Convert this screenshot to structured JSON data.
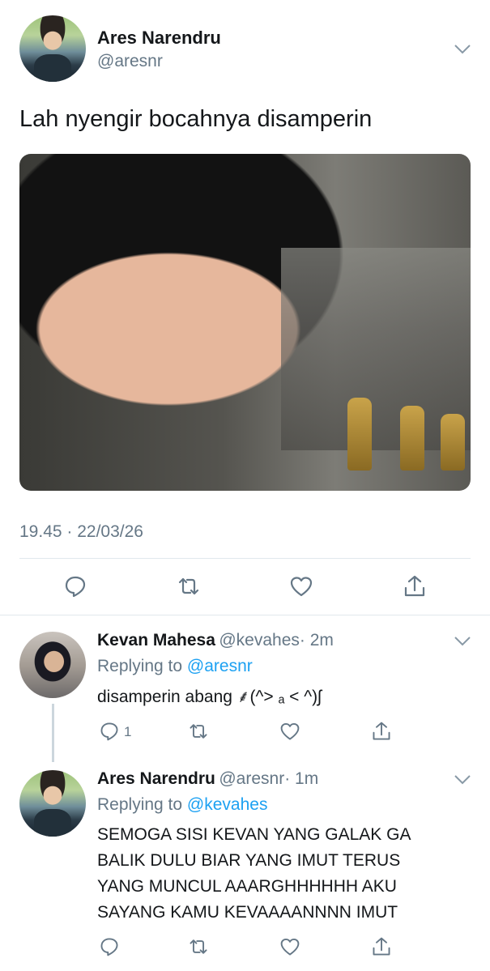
{
  "main_tweet": {
    "author_name": "Ares Narendru",
    "author_handle": "@aresnr",
    "text": "Lah nyengir bocahnya disamperin",
    "time": "19.45 · 22/03/26"
  },
  "replies": [
    {
      "author_name": "Kevan Mahesa",
      "author_handle": "@kevahes",
      "age": "· 2m",
      "replying_prefix": "Replying to",
      "replying_to": "@aresnr",
      "text": "disamperin abang ⸙(^> ₐ < ^)ʃ",
      "reply_count": "1"
    },
    {
      "author_name": "Ares Narendru",
      "author_handle": "@aresnr",
      "age": "· 1m",
      "replying_prefix": "Replying to",
      "replying_to": "@kevahes",
      "text_lines": [
        "SEMOGA SISI KEVAN YANG GALAK GA",
        "BALIK DULU BIAR YANG IMUT TERUS",
        "YANG MUNCUL AAARGHHHHHH AKU",
        "SAYANG KAMU KEVAAAANNNN IMUT"
      ]
    }
  ],
  "icons": {
    "reply": "speech-bubble-icon",
    "retweet": "retweet-icon",
    "like": "heart-icon",
    "share": "share-icon",
    "menu": "chevron-down-icon"
  },
  "colors": {
    "text": "#14171a",
    "secondary": "#657786",
    "link": "#1da1f2",
    "divider": "#e1e8ed"
  }
}
